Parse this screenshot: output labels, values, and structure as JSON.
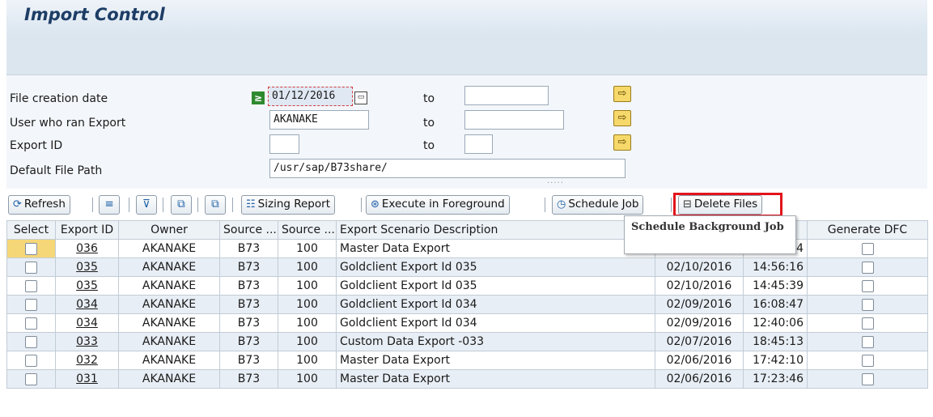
{
  "window": {
    "title": "Import Control"
  },
  "selection": {
    "file_creation_date": {
      "label": "File creation date",
      "from": "01/12/2016",
      "to_label": "to",
      "to": ""
    },
    "user_who_ran_export": {
      "label": "User who ran Export",
      "from": "AKANAKE",
      "to_label": "to",
      "to": ""
    },
    "export_id": {
      "label": "Export ID",
      "from": "",
      "to_label": "to",
      "to": ""
    },
    "default_file_path": {
      "label": "Default File Path",
      "value": "/usr/sap/B73share/"
    }
  },
  "toolbar": {
    "refresh": "Refresh",
    "sizing_report": "Sizing Report",
    "execute_foreground": "Execute in Foreground",
    "schedule_job": "Schedule Job",
    "delete_files": "Delete Files"
  },
  "tooltip": "Schedule Background Job",
  "table": {
    "headers": [
      "Select",
      "Export ID",
      "Owner",
      "Source ...",
      "Source ...",
      "Export Scenario Description",
      "",
      "",
      "Generate DFC"
    ],
    "rows": [
      {
        "id": "036",
        "owner": "AKANAKE",
        "sys": "B73",
        "client": "100",
        "desc": "Master Data Export",
        "date": "",
        "time": "4"
      },
      {
        "id": "035",
        "owner": "AKANAKE",
        "sys": "B73",
        "client": "100",
        "desc": "Goldclient Export Id 035",
        "date": "02/10/2016",
        "time": "14:56:16"
      },
      {
        "id": "035",
        "owner": "AKANAKE",
        "sys": "B73",
        "client": "100",
        "desc": "Goldclient Export Id 035",
        "date": "02/10/2016",
        "time": "14:45:39"
      },
      {
        "id": "034",
        "owner": "AKANAKE",
        "sys": "B73",
        "client": "100",
        "desc": "Goldclient Export Id 034",
        "date": "02/09/2016",
        "time": "16:08:47"
      },
      {
        "id": "034",
        "owner": "AKANAKE",
        "sys": "B73",
        "client": "100",
        "desc": "Goldclient Export Id 034",
        "date": "02/09/2016",
        "time": "12:40:06"
      },
      {
        "id": "033",
        "owner": "AKANAKE",
        "sys": "B73",
        "client": "100",
        "desc": "Custom Data Export -033",
        "date": "02/07/2016",
        "time": "18:45:13"
      },
      {
        "id": "032",
        "owner": "AKANAKE",
        "sys": "B73",
        "client": "100",
        "desc": "Master Data Export",
        "date": "02/06/2016",
        "time": "17:42:10"
      },
      {
        "id": "031",
        "owner": "AKANAKE",
        "sys": "B73",
        "client": "100",
        "desc": "Master Data Export",
        "date": "02/06/2016",
        "time": "17:23:46"
      }
    ]
  },
  "colors": {
    "highlight": "#e2141b",
    "title": "#1d3d66",
    "alt_row": "#e8eef5"
  }
}
